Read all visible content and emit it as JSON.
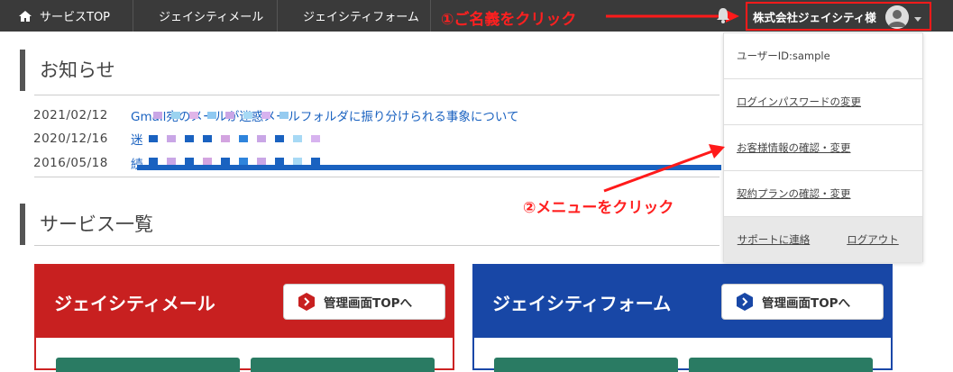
{
  "nav": {
    "items": [
      {
        "label": "サービスTOP",
        "icon": "home-icon"
      },
      {
        "label": "ジェイシティメール",
        "icon": "mail-icon"
      },
      {
        "label": "ジェイシティフォーム",
        "icon": "form-icon"
      }
    ],
    "user_name": "株式会社ジェイシティ様"
  },
  "annotations": {
    "step1": "①ご名義をクリック",
    "step2": "②メニューをクリック"
  },
  "news": {
    "title": "お知らせ",
    "items": [
      {
        "date": "2021/02/12",
        "text": "Gmail宛のメールが迷惑メールフォルダに振り分けられる事象について"
      },
      {
        "date": "2020/12/16",
        "text": "迷"
      },
      {
        "date": "2016/05/18",
        "text": "続"
      }
    ]
  },
  "services": {
    "title": "サービス一覧",
    "cards": [
      {
        "title": "ジェイシティメール",
        "button": "管理画面TOPへ",
        "color": "#c82020"
      },
      {
        "title": "ジェイシティフォーム",
        "button": "管理画面TOPへ",
        "color": "#1847a6"
      }
    ]
  },
  "dropdown": {
    "user_id": "ユーザーID:sample",
    "items": [
      "ログインパスワードの変更",
      "お客様情報の確認・変更",
      "契約プランの確認・変更"
    ],
    "footer": [
      "サポートに連絡",
      "ログアウト"
    ]
  },
  "colors": {
    "annotation": "#ff2020",
    "topbar": "#3a3a3a",
    "link": "#1a62c0"
  }
}
